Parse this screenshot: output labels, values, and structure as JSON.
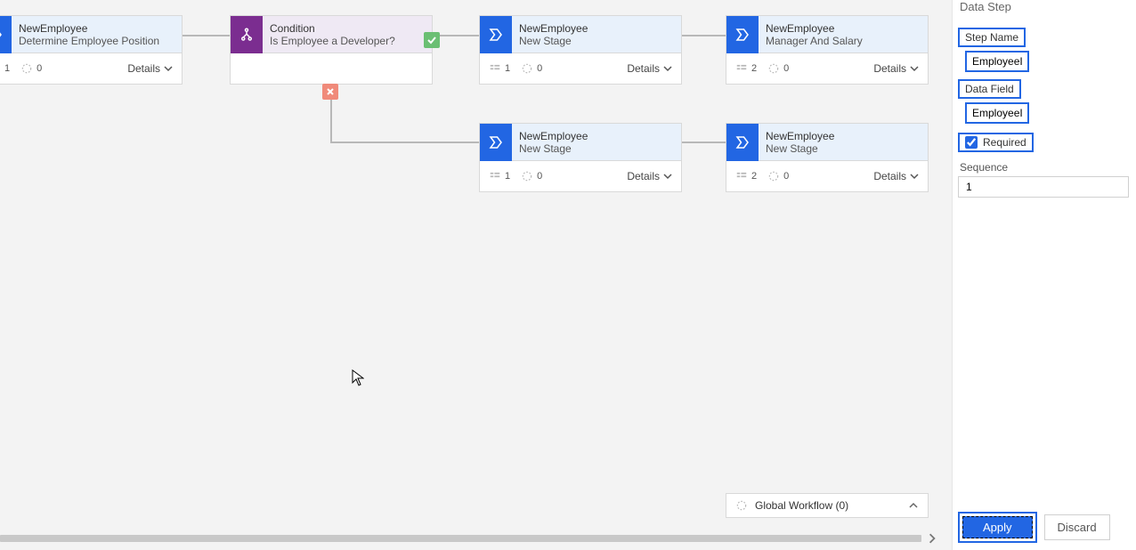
{
  "panel": {
    "section_title": "Data Step",
    "step_name_label": "Step Name",
    "step_name_value": "EmployeeID",
    "data_field_label": "Data Field",
    "data_field_value": "EmployeeID",
    "required_label": "Required",
    "required_checked": true,
    "sequence_label": "Sequence",
    "sequence_value": "1",
    "apply_label": "Apply",
    "discard_label": "Discard"
  },
  "global_workflow_label": "Global Workflow (0)",
  "details_label": "Details",
  "nodes": {
    "n0": {
      "title": "NewEmployee",
      "subtitle": "Determine Employee Position",
      "steps": "1",
      "other": "0"
    },
    "cond": {
      "title": "Condition",
      "subtitle": "Is Employee a Developer?"
    },
    "n1": {
      "title": "NewEmployee",
      "subtitle": "New Stage",
      "steps": "1",
      "other": "0"
    },
    "n2": {
      "title": "NewEmployee",
      "subtitle": "Manager And Salary",
      "steps": "2",
      "other": "0"
    },
    "n3": {
      "title": "NewEmployee",
      "subtitle": "New Stage",
      "steps": "1",
      "other": "0"
    },
    "n4": {
      "title": "NewEmployee",
      "subtitle": "New Stage",
      "steps": "2",
      "other": "0"
    }
  }
}
